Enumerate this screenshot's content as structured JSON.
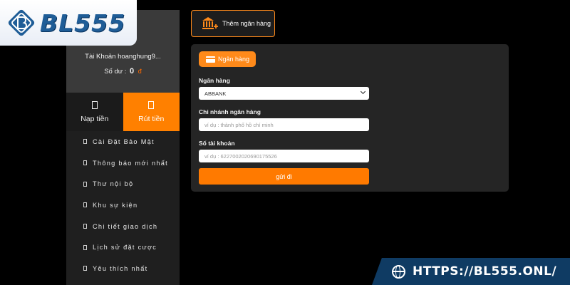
{
  "brand": {
    "logo_text": "BL555"
  },
  "account": {
    "name": "Tài Khoản hoanghung9...",
    "balance_label": "Số dư :",
    "balance_value": "0",
    "currency_symbol": "đ"
  },
  "tabs": {
    "deposit": "Nạp tiền",
    "withdraw": "Rút tiền"
  },
  "menu": [
    {
      "label": "Cài Đặt Bảo Mật"
    },
    {
      "label": "Thông báo mới nhất"
    },
    {
      "label": "Thư nội bộ"
    },
    {
      "label": "Khu sự kiện"
    },
    {
      "label": "Chi tiết giao dịch"
    },
    {
      "label": "Lịch sử đặt cược"
    },
    {
      "label": "Yêu thích nhất"
    }
  ],
  "add_bank": {
    "label": "Thêm ngân hàng"
  },
  "form": {
    "chip_label": "Ngân hàng",
    "bank_label": "Ngân hàng",
    "bank_selected": "ABBANK",
    "branch_label": "Chi nhánh ngân hàng",
    "branch_placeholder": "ví dụ : thành phố hồ chí minh",
    "account_label": "Số tài khoản",
    "account_placeholder": "ví dụ : 6227002020690175526",
    "submit_label": "gửi đi"
  },
  "banner": {
    "url": "HTTPS://BL555.ONL/"
  },
  "colors": {
    "accent": "#ff8000",
    "sidebar": "#1f1f1f",
    "panel": "#252525",
    "banner": "#0f3b63",
    "logo": "#1f5d97"
  }
}
